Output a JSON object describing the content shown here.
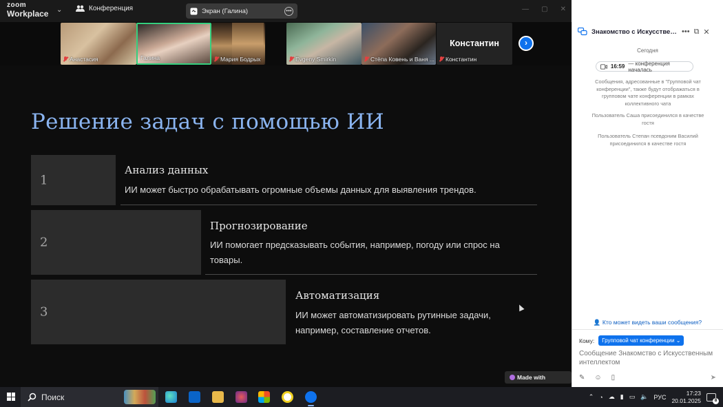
{
  "titlebar": {
    "brand_top": "zoom",
    "brand_bottom": "Workplace",
    "meeting_label": "Конференция",
    "share_label": "Экран (Галина)"
  },
  "participants": [
    {
      "name": "Анастасия",
      "muted": true
    },
    {
      "name": "Галина",
      "muted": false,
      "active": true
    },
    {
      "name": "Мария Бодрых",
      "muted": true
    },
    {
      "name": "Evgeny Smirkin",
      "muted": true
    },
    {
      "name": "Стёпа Ковень и Ваня ...",
      "muted": true
    },
    {
      "name": "Константин",
      "muted": true,
      "avatar_text": "Константин"
    }
  ],
  "slide": {
    "title": "Решение задач с помощью ИИ",
    "rows": [
      {
        "num": "1",
        "heading": "Анализ данных",
        "text": "ИИ может быстро обрабатывать огромные объемы данных для выявления трендов."
      },
      {
        "num": "2",
        "heading": "Прогнозирование",
        "text": "ИИ помогает предсказывать события, например, погоду или спрос на товары."
      },
      {
        "num": "3",
        "heading": "Автоматизация",
        "text": "ИИ может автоматизировать рутинные задачи, например, составление отчетов."
      }
    ],
    "badge": "Made with Gamma"
  },
  "chat": {
    "title": "Знакомство с Искусственным интеллектом",
    "today": "Сегодня",
    "start_time": "16:59",
    "start_text": "— конференция началась",
    "messages": [
      "Сообщения, адресованные в \"Групповой чат конференции\", также будут отображаться в групповом чате конференции в рамках коллективного чата",
      "Пользователь Саша присоединился в качестве гостя",
      "Пользователь Степан псевдоним Василий присоединился в качестве гостя"
    ],
    "who_sees": "Кто может видеть ваши сообщения?",
    "to_label": "Кому:",
    "to_value": "Групповой чат конференции",
    "input_placeholder": "Сообщение Знакомство с Искусственным интеллектом"
  },
  "taskbar": {
    "search_label": "Поиск",
    "lang": "РУС",
    "time": "17:23",
    "date": "20.01.2025",
    "notifications": "8"
  },
  "colors": {
    "slide_title": "#8ab4f0",
    "accent": "#0e72ed",
    "active_speaker": "#35d07f"
  }
}
